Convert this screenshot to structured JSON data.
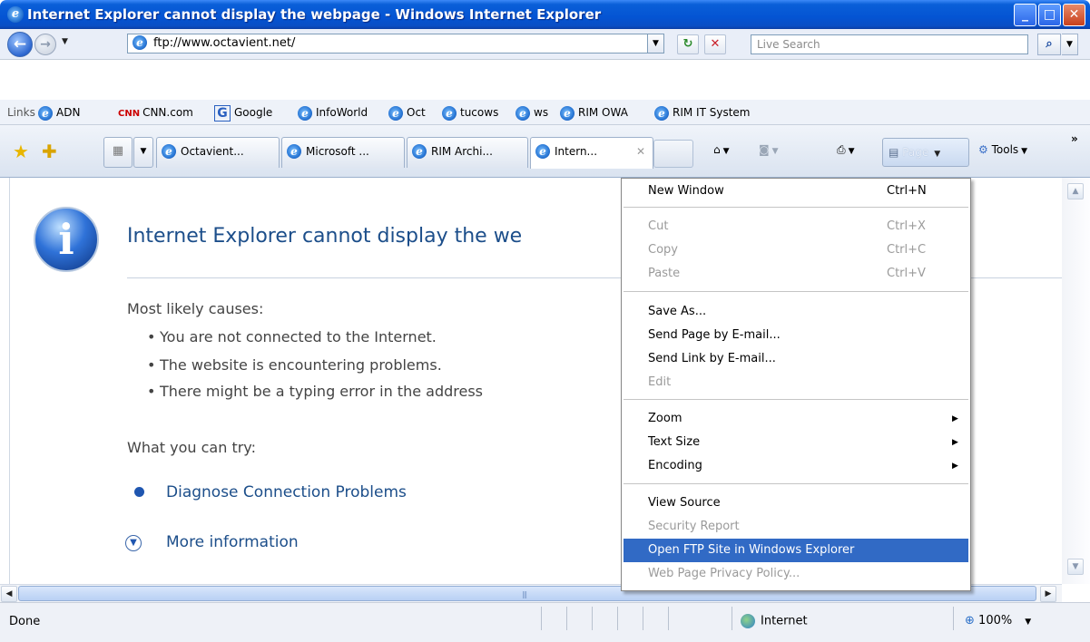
{
  "window": {
    "title": "Internet Explorer cannot display the webpage - Windows Internet Explorer",
    "minimize": "_",
    "maximize": "□",
    "close": "✕"
  },
  "nav": {
    "address": "ftp://www.octavient.net/",
    "search_placeholder": "Live Search",
    "back_glyph": "←",
    "forward_glyph": "→",
    "refresh_glyph": "↻",
    "stop_glyph": "✕",
    "search_glyph": "⌕"
  },
  "links": {
    "label": "Links",
    "items": [
      "ADN",
      "CNN.com",
      "Google",
      "InfoWorld",
      "Oct",
      "tucows",
      "ws",
      "RIM OWA",
      "RIM IT System"
    ]
  },
  "tabs": [
    {
      "label": "Octavient..."
    },
    {
      "label": "Microsoft ..."
    },
    {
      "label": "RIM Archi..."
    },
    {
      "label": "Intern...",
      "active": true
    }
  ],
  "commandbar": {
    "page": "Page",
    "tools": "Tools"
  },
  "content": {
    "heading": "Internet Explorer cannot display the we",
    "causes_title": "Most likely causes:",
    "causes": [
      "You are not connected to the Internet.",
      "The website is encountering problems.",
      "There might be a typing error in the address"
    ],
    "try_title": "What you can try:",
    "diagnose": "Diagnose Connection Problems",
    "more_info": "More information"
  },
  "menu": {
    "items": [
      {
        "label": "New Window",
        "shortcut": "Ctrl+N",
        "disabled": false
      },
      {
        "label": "Cut",
        "shortcut": "Ctrl+X",
        "disabled": true
      },
      {
        "label": "Copy",
        "shortcut": "Ctrl+C",
        "disabled": true
      },
      {
        "label": "Paste",
        "shortcut": "Ctrl+V",
        "disabled": true
      },
      {
        "label": "Save As...",
        "shortcut": "",
        "disabled": false
      },
      {
        "label": "Send Page by E-mail...",
        "shortcut": "",
        "disabled": false
      },
      {
        "label": "Send Link by E-mail...",
        "shortcut": "",
        "disabled": false
      },
      {
        "label": "Edit",
        "shortcut": "",
        "disabled": true
      },
      {
        "label": "Zoom",
        "submenu": true,
        "disabled": false
      },
      {
        "label": "Text Size",
        "submenu": true,
        "disabled": false
      },
      {
        "label": "Encoding",
        "submenu": true,
        "disabled": false
      },
      {
        "label": "View Source",
        "shortcut": "",
        "disabled": false
      },
      {
        "label": "Security Report",
        "shortcut": "",
        "disabled": true
      },
      {
        "label": "Open FTP Site in Windows Explorer",
        "shortcut": "",
        "disabled": false,
        "highlighted": true
      },
      {
        "label": "Web Page Privacy Policy...",
        "shortcut": "",
        "disabled": true
      }
    ]
  },
  "status": {
    "text": "Done",
    "zone": "Internet",
    "zoom": "100%"
  },
  "colors": {
    "titlebar": "#0454d3",
    "menu_highlight": "#316ac5",
    "link": "#1c4e8a"
  }
}
